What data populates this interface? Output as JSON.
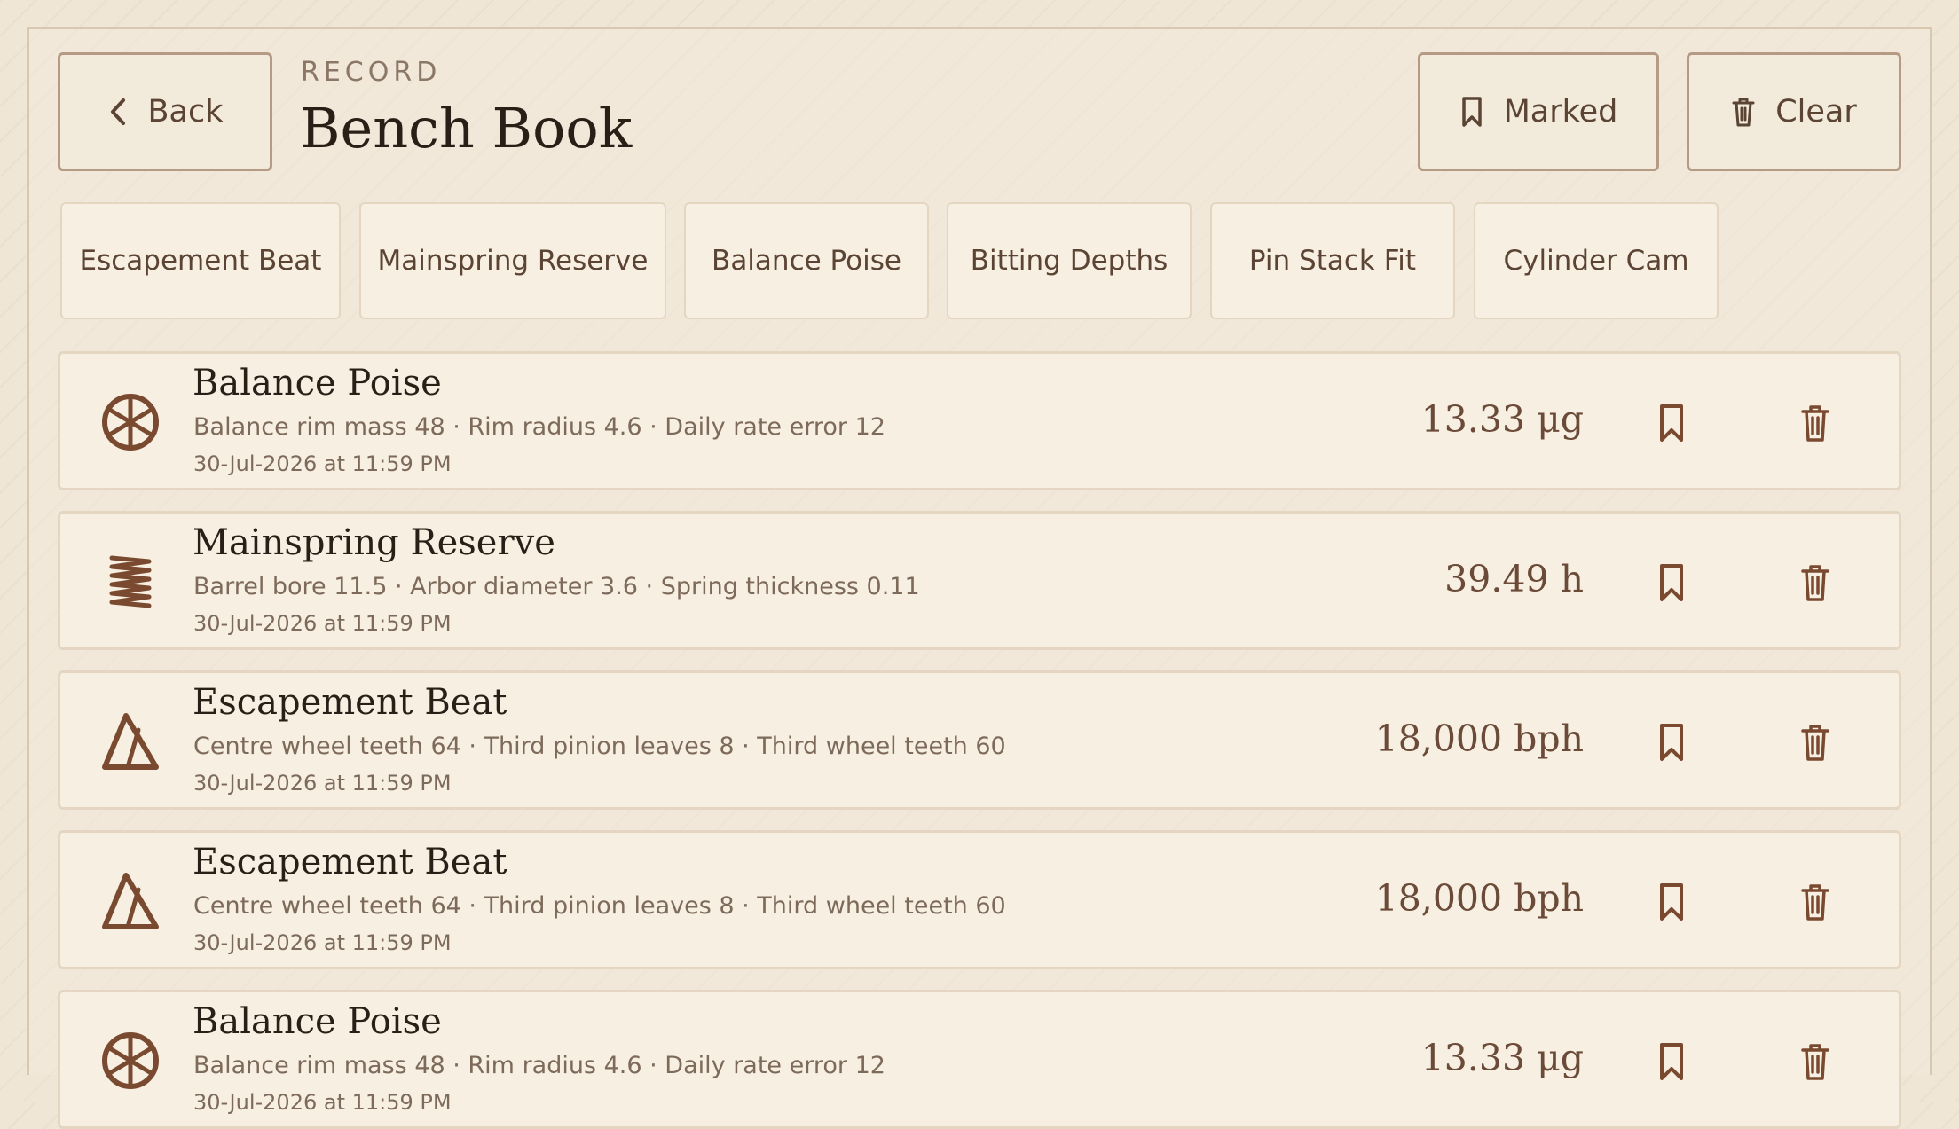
{
  "header": {
    "back_label": "Back",
    "eyebrow": "RECORD",
    "title": "Bench Book",
    "marked_label": "Marked",
    "clear_label": "Clear"
  },
  "tabs": [
    {
      "label": "Escapement Beat"
    },
    {
      "label": "Mainspring Reserve"
    },
    {
      "label": "Balance Poise"
    },
    {
      "label": "Bitting Depths"
    },
    {
      "label": "Pin Stack Fit"
    },
    {
      "label": "Cylinder Cam"
    }
  ],
  "entries": [
    {
      "icon": "balance-wheel-icon",
      "name": "Balance Poise",
      "params": "Balance rim mass 48 · Rim radius 4.6 · Daily rate error 12",
      "timestamp": "30-Jul-2026 at 11:59 PM",
      "result": "13.33 μg"
    },
    {
      "icon": "spring-coil-icon",
      "name": "Mainspring Reserve",
      "params": "Barrel bore 11.5 · Arbor diameter 3.6 · Spring thickness 0.11",
      "timestamp": "30-Jul-2026 at 11:59 PM",
      "result": "39.49 h"
    },
    {
      "icon": "metronome-icon",
      "name": "Escapement Beat",
      "params": "Centre wheel teeth 64 · Third pinion leaves 8 · Third wheel teeth 60",
      "timestamp": "30-Jul-2026 at 11:59 PM",
      "result": "18,000 bph"
    },
    {
      "icon": "metronome-icon",
      "name": "Escapement Beat",
      "params": "Centre wheel teeth 64 · Third pinion leaves 8 · Third wheel teeth 60",
      "timestamp": "30-Jul-2026 at 11:59 PM",
      "result": "18,000 bph"
    },
    {
      "icon": "balance-wheel-icon",
      "name": "Balance Poise",
      "params": "Balance rim mass 48 · Rim radius 4.6 · Daily rate error 12",
      "timestamp": "30-Jul-2026 at 11:59 PM",
      "result": "13.33 μg"
    }
  ],
  "colors": {
    "background": "#efe6d6",
    "card": "#f6efe2",
    "accent": "#7a4a30",
    "text": "#2a1f17",
    "muted": "#7d6a5a"
  }
}
